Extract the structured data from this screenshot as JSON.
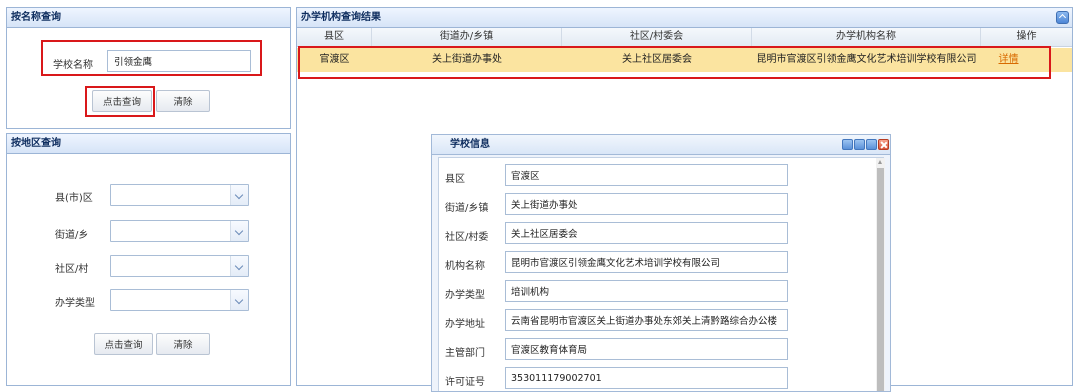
{
  "name_search": {
    "title": "按名称查询",
    "school_label": "学校名称",
    "school_value": "引领金鹰",
    "query_button": "点击查询",
    "clear_button": "清除"
  },
  "region_search": {
    "title": "按地区查询",
    "county_label": "县(市)区",
    "street_label": "街道/乡",
    "community_label": "社区/村",
    "type_label": "办学类型",
    "query_button": "点击查询",
    "clear_button": "清除"
  },
  "results": {
    "title": "办学机构查询结果",
    "columns": [
      "县区",
      "街道办/乡镇",
      "社区/村委会",
      "办学机构名称",
      "操作"
    ],
    "rows": [
      {
        "county": "官渡区",
        "street": "关上街道办事处",
        "community": "关上社区居委会",
        "name": "昆明市官渡区引领金鹰文化艺术培训学校有限公司",
        "action": "详情"
      }
    ]
  },
  "dialog": {
    "title": "学校信息",
    "fields": [
      {
        "label": "县区",
        "value": "官渡区"
      },
      {
        "label": "街道/乡镇",
        "value": "关上街道办事处"
      },
      {
        "label": "社区/村委",
        "value": "关上社区居委会"
      },
      {
        "label": "机构名称",
        "value": "昆明市官渡区引领金鹰文化艺术培训学校有限公司"
      },
      {
        "label": "办学类型",
        "value": "培训机构"
      },
      {
        "label": "办学地址",
        "value": "云南省昆明市官渡区关上街道办事处东郊关上清黔路综合办公楼"
      },
      {
        "label": "主管部门",
        "value": "官渡区教育体育局"
      },
      {
        "label": "许可证号",
        "value": "353011179002701"
      }
    ]
  },
  "colors": {
    "highlight_row": "#fbe4a0",
    "annotation_red": "#d9181a",
    "header_text": "#0e2d5f",
    "link": "#d86a00"
  }
}
